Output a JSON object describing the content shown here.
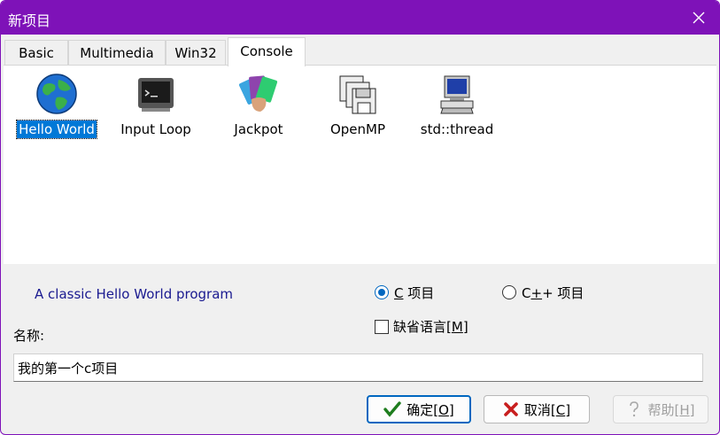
{
  "window": {
    "title": "新项目"
  },
  "tabs": [
    {
      "label": "Basic"
    },
    {
      "label": "Multimedia"
    },
    {
      "label": "Win32"
    },
    {
      "label": "Console"
    }
  ],
  "templates": [
    {
      "label": "Hello World",
      "icon": "globe-icon",
      "selected": true
    },
    {
      "label": "Input Loop",
      "icon": "terminal-icon"
    },
    {
      "label": "Jackpot",
      "icon": "cards-icon"
    },
    {
      "label": "OpenMP",
      "icon": "floppy-stack-icon"
    },
    {
      "label": "std::thread",
      "icon": "computer-icon"
    }
  ],
  "description": "A classic Hello World program",
  "language": {
    "c": {
      "prefix": "C",
      "suffix": " 项目",
      "checked": true
    },
    "cpp": {
      "prefix": "C",
      "mnemonic": "+",
      "suffix": "+ 项目",
      "checked": false
    }
  },
  "default_language": {
    "label": "缺省语言",
    "mnemonic": "M",
    "checked": false
  },
  "name": {
    "label": "名称:",
    "value": "我的第一个c项目"
  },
  "buttons": {
    "ok": {
      "label": "确定",
      "mnemonic": "O"
    },
    "cancel": {
      "label": "取消",
      "mnemonic": "C"
    },
    "help": {
      "label": "帮助",
      "mnemonic": "H",
      "disabled": true
    }
  },
  "colors": {
    "accent": "#7e12b8",
    "selection": "#0078d7",
    "description": "#1a1a90"
  }
}
